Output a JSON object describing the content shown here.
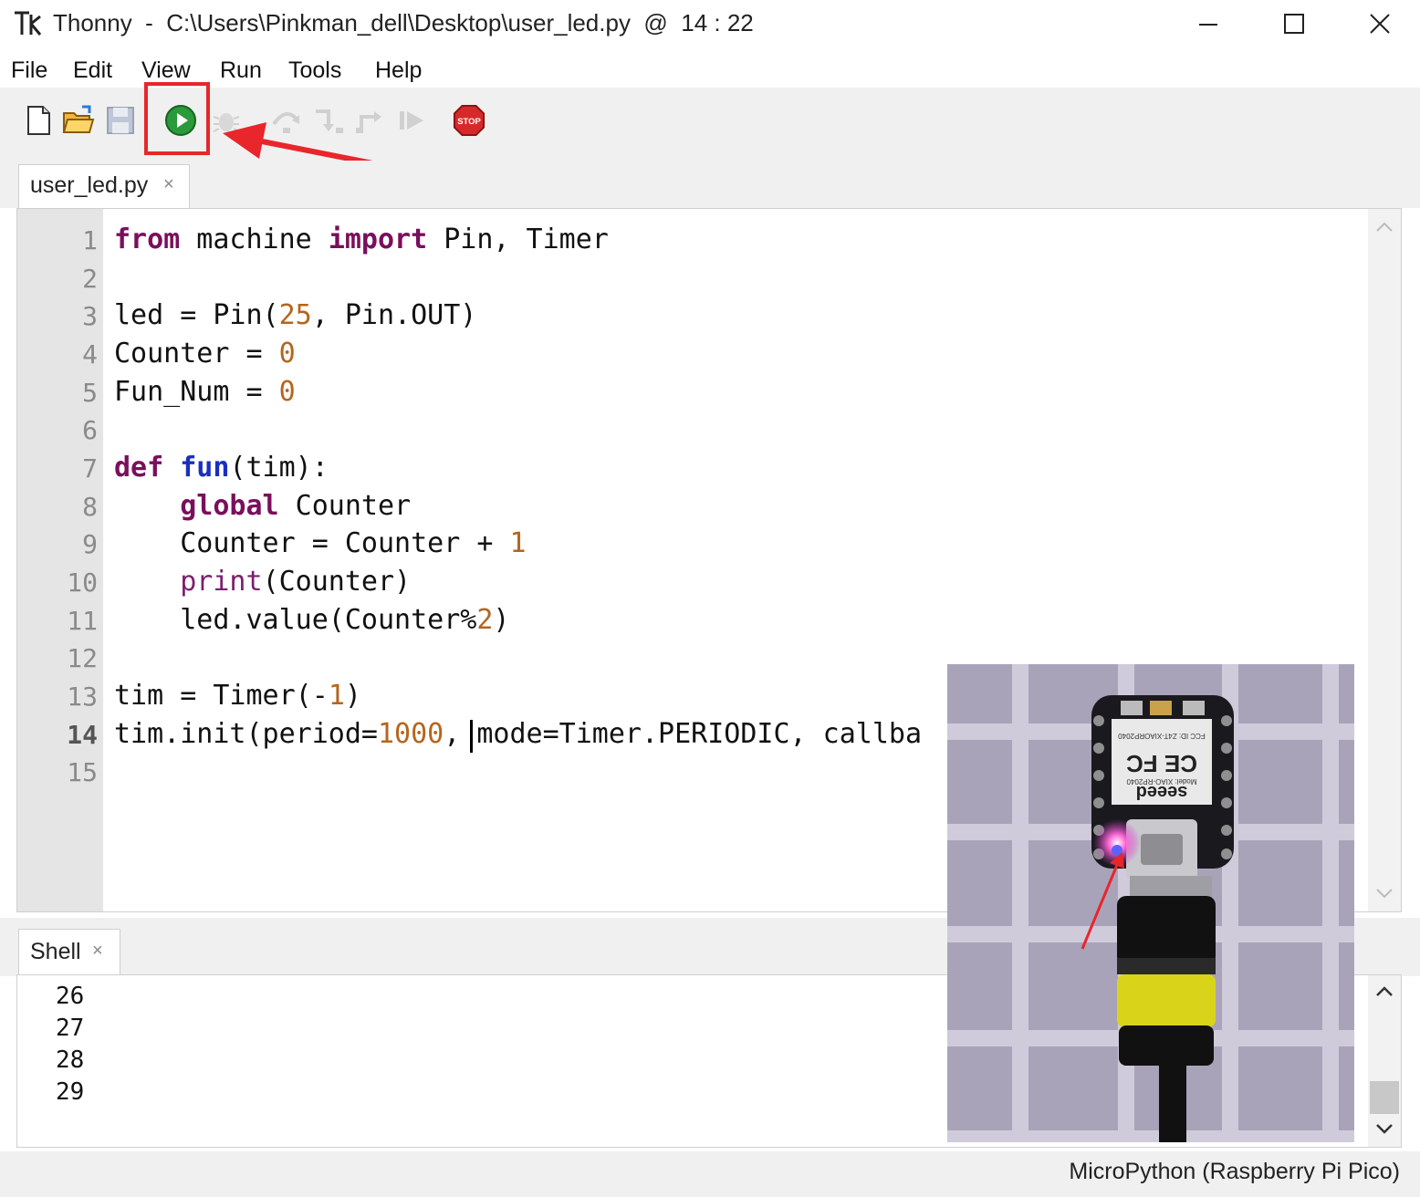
{
  "window": {
    "title": "Thonny  -  C:\\Users\\Pinkman_dell\\Desktop\\user_led.py  @  14 : 22",
    "controls": [
      "minimize",
      "maximize",
      "close"
    ]
  },
  "menu": [
    "File",
    "Edit",
    "View",
    "Run",
    "Tools",
    "Help"
  ],
  "toolbar": {
    "buttons": [
      "new-file",
      "open-file",
      "save-file",
      "run",
      "debug",
      "step-over",
      "step-into",
      "step-out",
      "resume",
      "stop"
    ],
    "stop_label": "STOP",
    "highlighted": "run"
  },
  "editor": {
    "tab": {
      "label": "user_led.py",
      "close": "×"
    },
    "current_line": 14,
    "lines": [
      "1",
      "2",
      "3",
      "4",
      "5",
      "6",
      "7",
      "8",
      "9",
      "10",
      "11",
      "12",
      "13",
      "14",
      "15"
    ],
    "code": {
      "l1_from": "from",
      "l1_mod": " machine ",
      "l1_import": "import",
      "l1_rest": " Pin, Timer",
      "l3_a": "led = Pin(",
      "l3_n": "25",
      "l3_b": ", Pin.OUT)",
      "l4_a": "Counter = ",
      "l4_n": "0",
      "l5_a": "Fun_Num = ",
      "l5_n": "0",
      "l7_def": "def",
      "l7_fn": "fun",
      "l7_rest": "(tim):",
      "l8_global": "global",
      "l8_rest": " Counter",
      "l9_a": "Counter = Counter + ",
      "l9_n": "1",
      "l10_print": "print",
      "l10_rest": "(Counter)",
      "l11_a": "led.value(Counter%",
      "l11_n": "2",
      "l11_b": ")",
      "l13_a": "tim = Timer(-",
      "l13_n": "1",
      "l13_b": ")",
      "l14_a": "tim.init(period=",
      "l14_n": "1000",
      "l14_b": ",",
      "l14_c": " mode=Timer.PERIODIC, callba"
    }
  },
  "shell": {
    "tab": {
      "label": "Shell",
      "close": "×"
    },
    "output": [
      "26",
      "27",
      "28",
      "29"
    ]
  },
  "status": {
    "interpreter": "MicroPython (Raspberry Pi Pico)"
  },
  "photo": {
    "board_model": "Model: XIAO-RP2040",
    "brand": "seeed",
    "fcc": "FCC ID: Z4T-XIAORP2040"
  },
  "colors": {
    "highlight_red": "#e8262b",
    "keyword": "#7a0f5c",
    "function": "#1a2fbf",
    "number": "#b5651d"
  }
}
